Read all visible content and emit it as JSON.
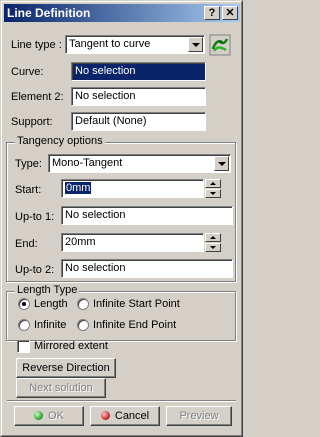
{
  "window": {
    "title": "Line Definition",
    "help_glyph": "?",
    "close_glyph": "✕"
  },
  "line_type": {
    "label": "Line type :",
    "value": "Tangent to curve",
    "icon": "reverse-tangent-icon"
  },
  "curve": {
    "label": "Curve:",
    "value": "No selection"
  },
  "element2": {
    "label": "Element 2:",
    "value": "No selection"
  },
  "support": {
    "label": "Support:",
    "value": "Default (None)"
  },
  "tangency": {
    "title": "Tangency options",
    "type_label": "Type:",
    "type_value": "Mono-Tangent",
    "start_label": "Start:",
    "start_value": "0mm",
    "upto1_label": "Up-to 1:",
    "upto1_value": "No selection",
    "end_label": "End:",
    "end_value": "20mm",
    "upto2_label": "Up-to 2:",
    "upto2_value": "No selection"
  },
  "length_type": {
    "title": "Length Type",
    "options": [
      {
        "label": "Length",
        "checked": true
      },
      {
        "label": "Infinite Start Point",
        "checked": false
      },
      {
        "label": "Infinite",
        "checked": false
      },
      {
        "label": "Infinite End Point",
        "checked": false
      }
    ]
  },
  "mirrored": {
    "label": "Mirrored extent",
    "checked": false
  },
  "buttons": {
    "reverse": "Reverse Direction",
    "next": "Next solution",
    "ok": "OK",
    "cancel": "Cancel",
    "preview": "Preview"
  },
  "colors": {
    "title_start": "#0a246a",
    "title_end": "#a6caf0",
    "selection": "#0a246a",
    "face": "#d4d0c8"
  }
}
